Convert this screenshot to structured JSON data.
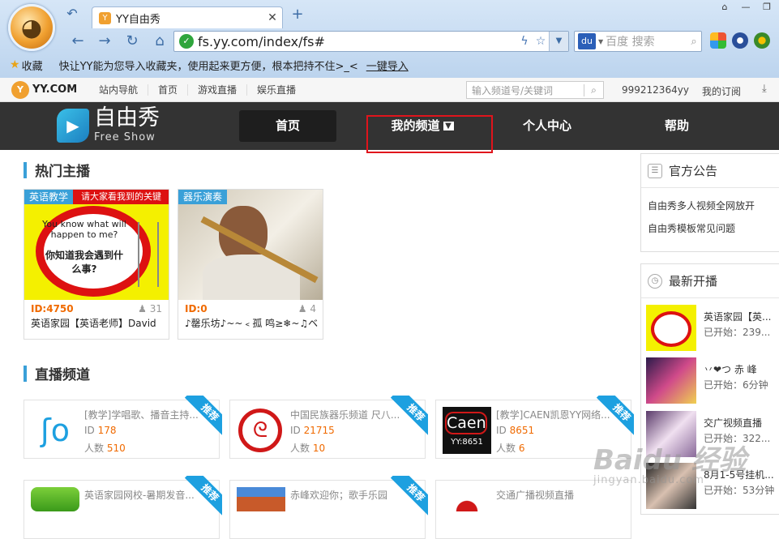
{
  "browser": {
    "tab_title": "YY自由秀",
    "address": "fs.yy.com/index/fs#",
    "search_placeholder": "百度 搜索",
    "bookmarks_label": "收藏",
    "import_message": "快让YY能为您导入收藏夹，使用起来更方便，根本把持不住>_<",
    "import_link": "一键导入"
  },
  "site_top": {
    "logo_text": "YY.COM",
    "links": [
      "站内导航",
      "首页",
      "游戏直播",
      "娱乐直播"
    ],
    "search_placeholder": "输入频道号/关键词",
    "user_id": "999212364yy",
    "my_subscription": "我的订阅"
  },
  "brand": {
    "name_cn": "自由秀",
    "name_en": "Free Show"
  },
  "nav": {
    "home": "首页",
    "my_channel": "我的频道",
    "personal": "个人中心",
    "help": "帮助"
  },
  "hot": {
    "title": "热门主播",
    "cards": [
      {
        "tag": "英语教学",
        "id": "ID:4750",
        "count": "31",
        "name": "英语家园【英语老师】David",
        "thumb_text_1": "You know what will happen to me?",
        "thumb_text_2": "你知道我会遇到什么事?",
        "banner": "请大家看我到的关键"
      },
      {
        "tag": "器乐演奏",
        "id": "ID:0",
        "count": "4",
        "name": "♪罄乐坊♪~~﹤孤 鸣≥❄~♫ベ"
      }
    ]
  },
  "live_channels": {
    "title": "直播频道",
    "badge": "推荐",
    "items": [
      {
        "title": "[教学]学唱歌、播音主持...",
        "id_label": "ID",
        "id": "178",
        "people_label": "人数",
        "people": "510"
      },
      {
        "title": "中国民族器乐频道 尺八...",
        "id_label": "ID",
        "id": "21715",
        "people_label": "人数",
        "people": "10"
      },
      {
        "title": "[教学]CAEN凯恩YY网络...",
        "id_label": "ID",
        "id": "8651",
        "people_label": "人数",
        "people": "6",
        "logo_text": "Caen",
        "logo_sub": "YY:8651"
      },
      {
        "title": "英语家园网校-暑期发音..."
      },
      {
        "title": "赤峰欢迎你；歌手乐园"
      },
      {
        "title": "交通广播视频直播"
      }
    ]
  },
  "notice": {
    "title": "官方公告",
    "items": [
      "自由秀多人视频全网放开",
      "自由秀模板常见问题"
    ]
  },
  "latest": {
    "title": "最新开播",
    "items": [
      {
        "name": "英语家园【英...",
        "start": "已开始：239..."
      },
      {
        "name": "丷❤つ 赤 峰",
        "start": "已开始：6分钟"
      },
      {
        "name": "交广视频直播",
        "start": "已开始：322..."
      },
      {
        "name": "8月1-5号挂机...",
        "start": "已开始：53分钟"
      }
    ]
  },
  "watermark": {
    "main": "Baidu 经验",
    "sub": "jingyan.baidu.com"
  }
}
